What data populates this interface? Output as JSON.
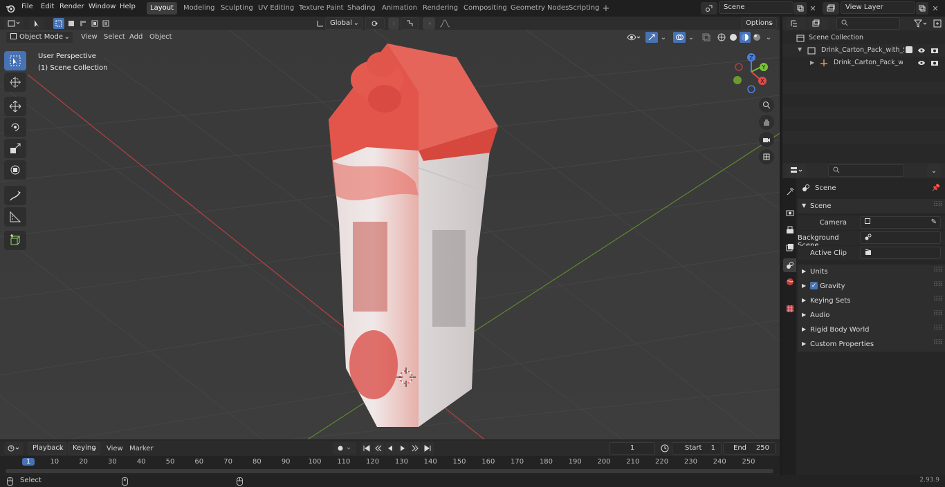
{
  "menubar": {
    "items": [
      "File",
      "Edit",
      "Render",
      "Window",
      "Help"
    ],
    "workspaces": [
      "Layout",
      "Modeling",
      "Sculpting",
      "UV Editing",
      "Texture Paint",
      "Shading",
      "Animation",
      "Rendering",
      "Compositing",
      "Geometry Nodes",
      "Scripting"
    ],
    "active_workspace": "Layout",
    "scene_name": "Scene",
    "view_layer": "View Layer"
  },
  "viewport_header": {
    "mode": "Object Mode",
    "menus": [
      "View",
      "Select",
      "Add",
      "Object"
    ],
    "orientation": "Global",
    "options_label": "Options"
  },
  "viewport": {
    "perspective_label": "User Perspective",
    "collection_label": "(1) Scene Collection",
    "gizmo_axes": [
      "Z",
      "Y",
      "X"
    ]
  },
  "timeline": {
    "menus": [
      "Playback",
      "Keying",
      "View",
      "Marker"
    ],
    "current_frame": "1",
    "start_label": "Start",
    "start_value": "1",
    "end_label": "End",
    "end_value": "250",
    "ruler": [
      "1",
      "10",
      "20",
      "30",
      "40",
      "50",
      "60",
      "70",
      "80",
      "90",
      "100",
      "110",
      "120",
      "130",
      "140",
      "150",
      "160",
      "170",
      "180",
      "190",
      "200",
      "210",
      "220",
      "230",
      "240",
      "250"
    ]
  },
  "status": {
    "left_label": "Select",
    "version": "2.93.9"
  },
  "outliner": {
    "root": "Scene Collection",
    "items": [
      {
        "label": "Drink_Carton_Pack_with_Scre"
      },
      {
        "label": "Drink_Carton_Pack_with_"
      }
    ]
  },
  "properties": {
    "context": "Scene",
    "panel": "Scene",
    "camera_label": "Camera",
    "bg_scene_label": "Background Scene",
    "active_clip_label": "Active Clip",
    "subpanels": [
      "Units",
      "Gravity",
      "Keying Sets",
      "Audio",
      "Rigid Body World",
      "Custom Properties"
    ],
    "gravity_checked": true
  },
  "colors": {
    "accent": "#4772b3",
    "viewport_bg": "#3b3b3b",
    "carton_red": "#e0564b",
    "x_axis": "#d6453f",
    "y_axis": "#6fa83a"
  }
}
